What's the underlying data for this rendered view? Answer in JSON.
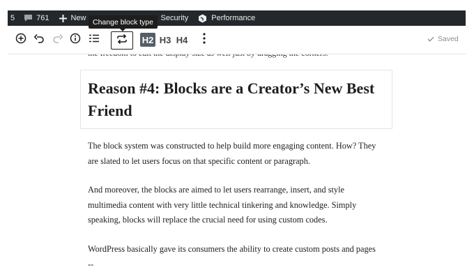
{
  "admin_bar": {
    "count_left": "5",
    "comments_count": "761",
    "new_label": "New",
    "security_label": "Security",
    "performance_label": "Performance"
  },
  "toolbar": {
    "tooltip": "Change block type",
    "heading_levels": [
      "H2",
      "H3",
      "H4"
    ],
    "saved_label": "Saved"
  },
  "content": {
    "clipped_line": "the freedom to edit the display size as well just by dragging the corners.",
    "heading": "Reason #4: Blocks are a Creator’s New Best Friend",
    "paragraphs": [
      "The block system was constructed to help build more engaging content. How? They are slated to let users focus on that specific content or paragraph.",
      "And moreover, the blocks are aimed to let users rearrange, insert, and style multimedia content with very little technical tinkering and knowledge. Simply speaking, blocks will replace the crucial need for using custom codes.",
      "WordPress basically gave its consumers the ability to create custom posts and pages --"
    ]
  }
}
